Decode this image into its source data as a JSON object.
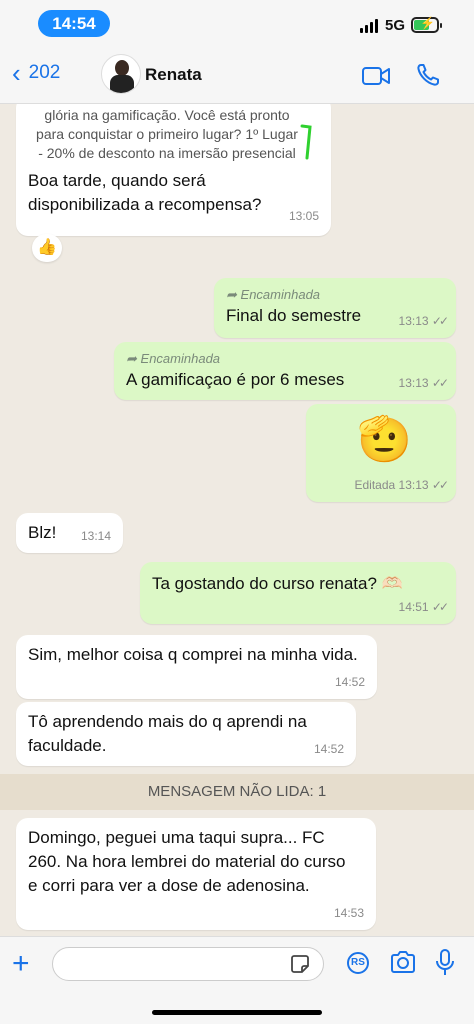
{
  "status": {
    "time": "14:54",
    "network": "5G"
  },
  "header": {
    "back_count": "202",
    "contact_name": "Renata"
  },
  "messages": {
    "m0": {
      "quoted": "glória na gamificação. Você está pronto para conquistar o primeiro lugar? 1º Lugar - 20% de desconto na imersão presencial",
      "text": "Boa tarde, quando será disponibilizada a recompensa?",
      "time": "13:05",
      "reaction": "👍"
    },
    "m1": {
      "forwarded": "Encaminhada",
      "text": "Final do semestre",
      "time": "13:13"
    },
    "m2": {
      "forwarded": "Encaminhada",
      "text": "A gamificaçao é por 6 meses",
      "time": "13:13"
    },
    "m3": {
      "emoji": "🫡",
      "edited": "Editada",
      "time": "13:13"
    },
    "m4": {
      "text": "Blz!",
      "time": "13:14"
    },
    "m5": {
      "text": "Ta gostando do curso renata? 🫶🏻",
      "time": "14:51"
    },
    "m6": {
      "text": "Sim, melhor coisa q comprei na minha vida.",
      "time": "14:52"
    },
    "m7": {
      "text": "Tô aprendendo mais do q aprendi na faculdade.",
      "time": "14:52"
    },
    "unread": "MENSAGEM NÃO LIDA: 1",
    "m8": {
      "text": "Domingo, peguei uma taqui supra... FC 260. Na hora lembrei do material do curso e corri para ver a dose de adenosina.",
      "time": "14:53"
    }
  },
  "composer": {
    "input_value": "",
    "rs_label": "RS"
  },
  "colors": {
    "accent": "#1a73e8",
    "outgoing": "#dcf8c6",
    "incoming": "#ffffff"
  }
}
